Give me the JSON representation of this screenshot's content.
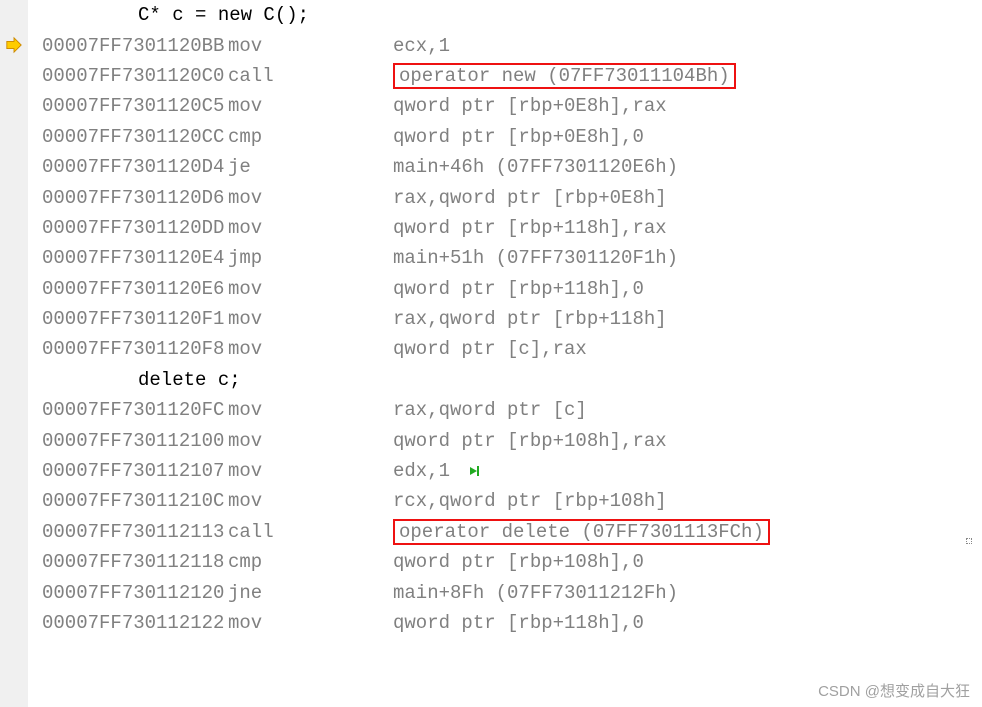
{
  "source": {
    "line1": "C* c = new C();",
    "line2": "delete c;"
  },
  "rows": [
    {
      "type": "src",
      "key": "source.line1"
    },
    {
      "addr": "00007FF7301120BB",
      "mnemonic": "mov",
      "operand": "ecx,1",
      "arrow": true
    },
    {
      "addr": "00007FF7301120C0",
      "mnemonic": "call",
      "operand": "operator new (07FF73011104Bh)",
      "hl": true
    },
    {
      "addr": "00007FF7301120C5",
      "mnemonic": "mov",
      "operand": "qword ptr [rbp+0E8h],rax"
    },
    {
      "addr": "00007FF7301120CC",
      "mnemonic": "cmp",
      "operand": "qword ptr [rbp+0E8h],0"
    },
    {
      "addr": "00007FF7301120D4",
      "mnemonic": "je",
      "operand": "main+46h (07FF7301120E6h)"
    },
    {
      "addr": "00007FF7301120D6",
      "mnemonic": "mov",
      "operand": "rax,qword ptr [rbp+0E8h]"
    },
    {
      "addr": "00007FF7301120DD",
      "mnemonic": "mov",
      "operand": "qword ptr [rbp+118h],rax"
    },
    {
      "addr": "00007FF7301120E4",
      "mnemonic": "jmp",
      "operand": "main+51h (07FF7301120F1h)"
    },
    {
      "addr": "00007FF7301120E6",
      "mnemonic": "mov",
      "operand": "qword ptr [rbp+118h],0"
    },
    {
      "addr": "00007FF7301120F1",
      "mnemonic": "mov",
      "operand": "rax,qword ptr [rbp+118h]"
    },
    {
      "addr": "00007FF7301120F8",
      "mnemonic": "mov",
      "operand": "qword ptr [c],rax"
    },
    {
      "type": "src",
      "key": "source.line2"
    },
    {
      "addr": "00007FF7301120FC",
      "mnemonic": "mov",
      "operand": "rax,qword ptr [c]"
    },
    {
      "addr": "00007FF730112100",
      "mnemonic": "mov",
      "operand": "qword ptr [rbp+108h],rax"
    },
    {
      "addr": "00007FF730112107",
      "mnemonic": "mov",
      "operand": "edx,1",
      "cursor": true
    },
    {
      "addr": "00007FF73011210C",
      "mnemonic": "mov",
      "operand": "rcx,qword ptr [rbp+108h]"
    },
    {
      "addr": "00007FF730112113",
      "mnemonic": "call",
      "operand": "operator delete (07FF7301113FCh)",
      "hl": true
    },
    {
      "addr": "00007FF730112118",
      "mnemonic": "cmp",
      "operand": "qword ptr [rbp+108h],0"
    },
    {
      "addr": "00007FF730112120",
      "mnemonic": "jne",
      "operand": "main+8Fh (07FF73011212Fh)"
    },
    {
      "addr": "00007FF730112122",
      "mnemonic": "mov",
      "operand": "qword ptr [rbp+118h],0"
    }
  ],
  "watermark": "CSDN @想变成自大狂"
}
